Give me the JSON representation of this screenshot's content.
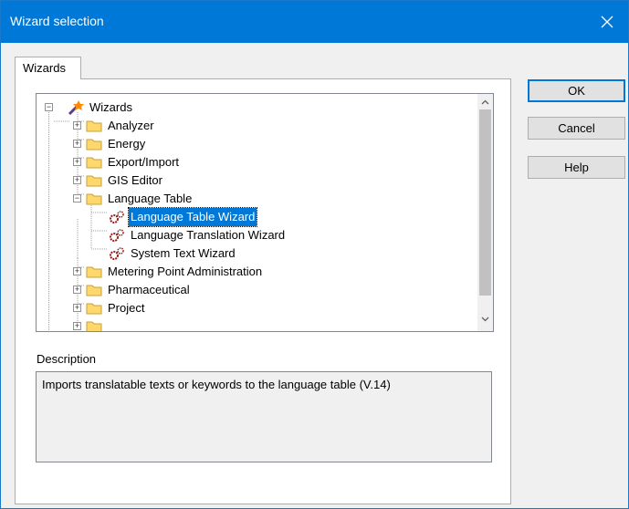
{
  "window": {
    "title": "Wizard selection"
  },
  "tabs": [
    {
      "label": "Wizards"
    }
  ],
  "tree": {
    "root": "Wizards",
    "items": [
      {
        "label": "Analyzer"
      },
      {
        "label": "Energy"
      },
      {
        "label": "Export/Import"
      },
      {
        "label": "GIS Editor"
      },
      {
        "label": "Language Table",
        "children": [
          {
            "label": "Language Table Wizard",
            "selected": true
          },
          {
            "label": "Language Translation Wizard"
          },
          {
            "label": "System Text Wizard"
          }
        ]
      },
      {
        "label": "Metering Point Administration"
      },
      {
        "label": "Pharmaceutical"
      },
      {
        "label": "Project"
      }
    ]
  },
  "description": {
    "label": "Description",
    "text": "Imports translatable texts or keywords to the language table (V.14)"
  },
  "buttons": {
    "ok": "OK",
    "cancel": "Cancel",
    "help": "Help"
  },
  "colors": {
    "titlebar": "#0078d7",
    "selection": "#0078d7",
    "folder": "#ffd86b"
  }
}
